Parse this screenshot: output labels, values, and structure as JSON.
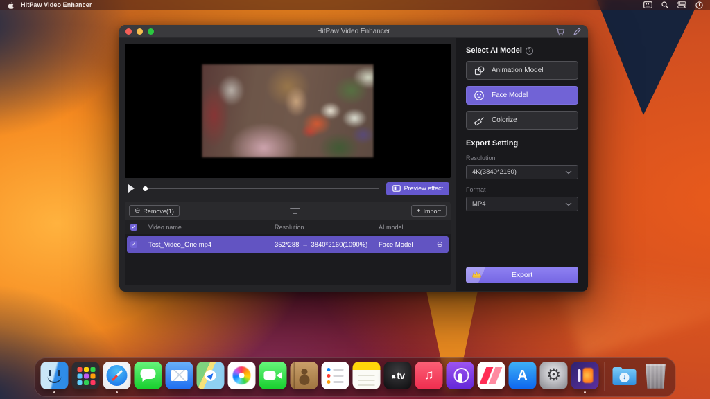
{
  "menu_bar": {
    "app_name": "HitPaw Video Enhancer",
    "status_icons": [
      "input-source-icon",
      "spotlight-search-icon",
      "control-center-icon",
      "clock-icon"
    ]
  },
  "window": {
    "title": "HitPaw Video Enhancer",
    "titlebar_icons": [
      "cart-icon",
      "brush-icon"
    ],
    "player": {
      "preview_button_label": "Preview effect",
      "progress_position": 0
    },
    "file_panel": {
      "remove_button_label": "Remove(1)",
      "import_button_label": "Import",
      "columns": [
        "Video name",
        "Resolution",
        "AI model"
      ],
      "row": {
        "video_name": "Test_Video_One.mp4",
        "resolution_from": "352*288",
        "resolution_to": "3840*2160(1090%)",
        "ai_model": "Face Model",
        "checked": true
      }
    },
    "right_panel": {
      "select_ai_model_title": "Select AI Model",
      "model_buttons": [
        {
          "label": "Animation Model",
          "selected": false
        },
        {
          "label": "Face Model",
          "selected": true
        },
        {
          "label": "Colorize",
          "selected": false
        }
      ],
      "export_setting_title": "Export Setting",
      "resolution_label": "Resolution",
      "resolution_value": "4K(3840*2160)",
      "format_label": "Format",
      "format_value": "MP4",
      "export_button_label": "Export"
    }
  },
  "dock": {
    "items": [
      "finder",
      "launchpad",
      "safari",
      "messages",
      "mail",
      "maps",
      "photos",
      "facetime",
      "contacts",
      "reminders",
      "notes",
      "tv",
      "music",
      "podcasts",
      "news",
      "app-store",
      "system-settings",
      "hitpaw-video-enhancer",
      "downloads",
      "trash"
    ],
    "running_apps": [
      "finder",
      "safari",
      "hitpaw-video-enhancer"
    ],
    "tv_label": "tv",
    "appstore_label": "A"
  },
  "glyphs": {
    "info": "?",
    "plus": "+",
    "minus": "⊖",
    "arrow": "→",
    "check": "✓",
    "music_note": "♫",
    "gear": "⚙",
    "download_arrow": "↓"
  },
  "colors": {
    "accent_purple": "#7163d6",
    "row_purple": "#6254c2",
    "export_gradient_top": "#8f82f2",
    "export_gradient_bottom": "#7566e3",
    "traffic_red": "#f55f57",
    "traffic_yellow": "#f6be4f",
    "traffic_green": "#2ac840"
  }
}
